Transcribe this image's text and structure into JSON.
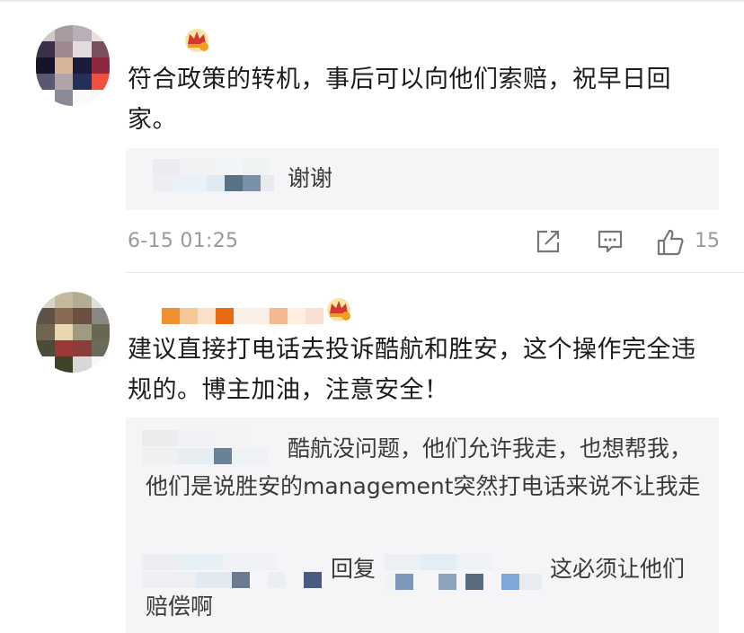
{
  "comments": [
    {
      "text": "符合政策的转机，事后可以向他们索赔，祝早日回家。",
      "reply": {
        "text": "谢谢"
      },
      "timestamp": "6-15 01:25",
      "likes": "15"
    },
    {
      "text": "建议直接打电话去投诉酷航和胜安，这个操作完全违规的。博主加油，注意安全！",
      "replies": [
        {
          "text": "酷航没问题，他们允许我走，也想帮我，他们是说胜安的management突然打电话来说不让我走"
        },
        {
          "verb": "回复",
          "text": "这必须让他们赔偿啊"
        }
      ]
    }
  ],
  "icons": [
    "vip-crown-icon",
    "share-icon",
    "comment-icon",
    "like-icon"
  ],
  "colors": {
    "accent": "#f0a020",
    "muted": "#9a9a9a",
    "reply_bg": "#f5f5f7"
  }
}
